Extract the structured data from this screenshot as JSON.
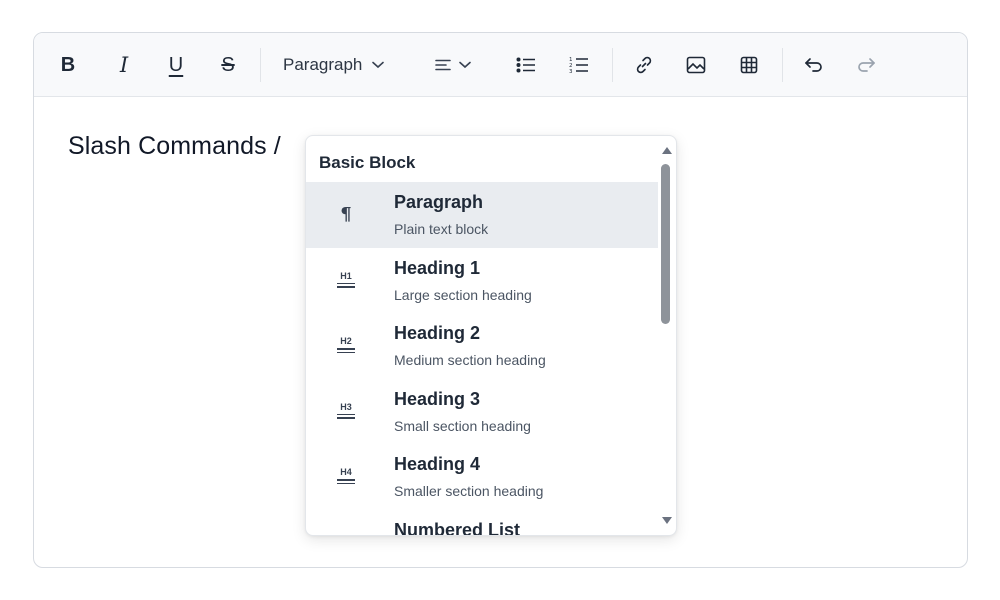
{
  "toolbar": {
    "bold_label": "B",
    "italic_label": "I",
    "underline_label": "U",
    "strike_label": "S",
    "block_type": "Paragraph",
    "redo_color": "#9aa3ae"
  },
  "editor": {
    "content": "Slash Commands /"
  },
  "menu": {
    "title": "Basic Block",
    "items": [
      {
        "label": "Paragraph",
        "description": "Plain text block",
        "icon": "pilcrow-icon",
        "glyph": "¶"
      },
      {
        "label": "Heading 1",
        "description": "Large section heading",
        "icon": "heading-1-icon",
        "glyph": "H1"
      },
      {
        "label": "Heading 2",
        "description": "Medium section heading",
        "icon": "heading-2-icon",
        "glyph": "H2"
      },
      {
        "label": "Heading 3",
        "description": "Small section heading",
        "icon": "heading-3-icon",
        "glyph": "H3"
      },
      {
        "label": "Heading 4",
        "description": "Smaller section heading",
        "icon": "heading-4-icon",
        "glyph": "H4"
      },
      {
        "label": "Numbered List",
        "description": "",
        "icon": "numbered-list-icon",
        "glyph": ""
      }
    ],
    "active_highlight": "#e9ecf0"
  }
}
